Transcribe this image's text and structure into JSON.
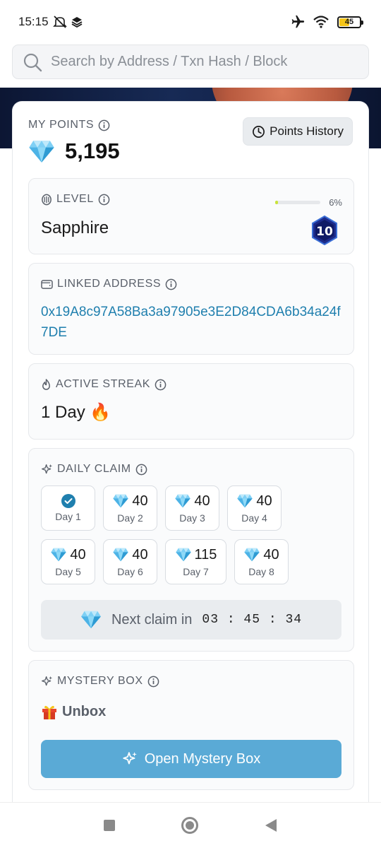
{
  "status": {
    "time": "15:15",
    "battery": "45"
  },
  "search": {
    "placeholder": "Search by Address / Txn Hash / Block"
  },
  "points": {
    "label": "MY POINTS",
    "value": "5,195",
    "history_button": "Points History"
  },
  "level": {
    "label": "LEVEL",
    "name": "Sapphire",
    "progress_text": "6%",
    "progress_fraction": 0.06,
    "badge_number": "10"
  },
  "linked": {
    "label": "LINKED ADDRESS",
    "address": "0x19A8c97A58Ba3a97905e3E2D84CDA6b34a24f7DE"
  },
  "streak": {
    "label": "ACTIVE STREAK",
    "value": "1 Day 🔥"
  },
  "daily_claim": {
    "label": "DAILY CLAIM",
    "days": [
      {
        "label": "Day 1",
        "value": "",
        "claimed": true
      },
      {
        "label": "Day 2",
        "value": "40",
        "claimed": false
      },
      {
        "label": "Day 3",
        "value": "40",
        "claimed": false
      },
      {
        "label": "Day 4",
        "value": "40",
        "claimed": false
      },
      {
        "label": "Day 5",
        "value": "40",
        "claimed": false
      },
      {
        "label": "Day 6",
        "value": "40",
        "claimed": false
      },
      {
        "label": "Day 7",
        "value": "115",
        "claimed": false
      },
      {
        "label": "Day 8",
        "value": "40",
        "claimed": false
      }
    ],
    "next_claim_text": "Next claim in",
    "timer": "03 : 45 : 34"
  },
  "mystery": {
    "label": "MYSTERY BOX",
    "unbox": "Unbox",
    "open_button": "Open Mystery Box"
  },
  "colors": {
    "accent": "#1f7fae",
    "button": "#5aaad6",
    "progress": "#c9e33a"
  }
}
